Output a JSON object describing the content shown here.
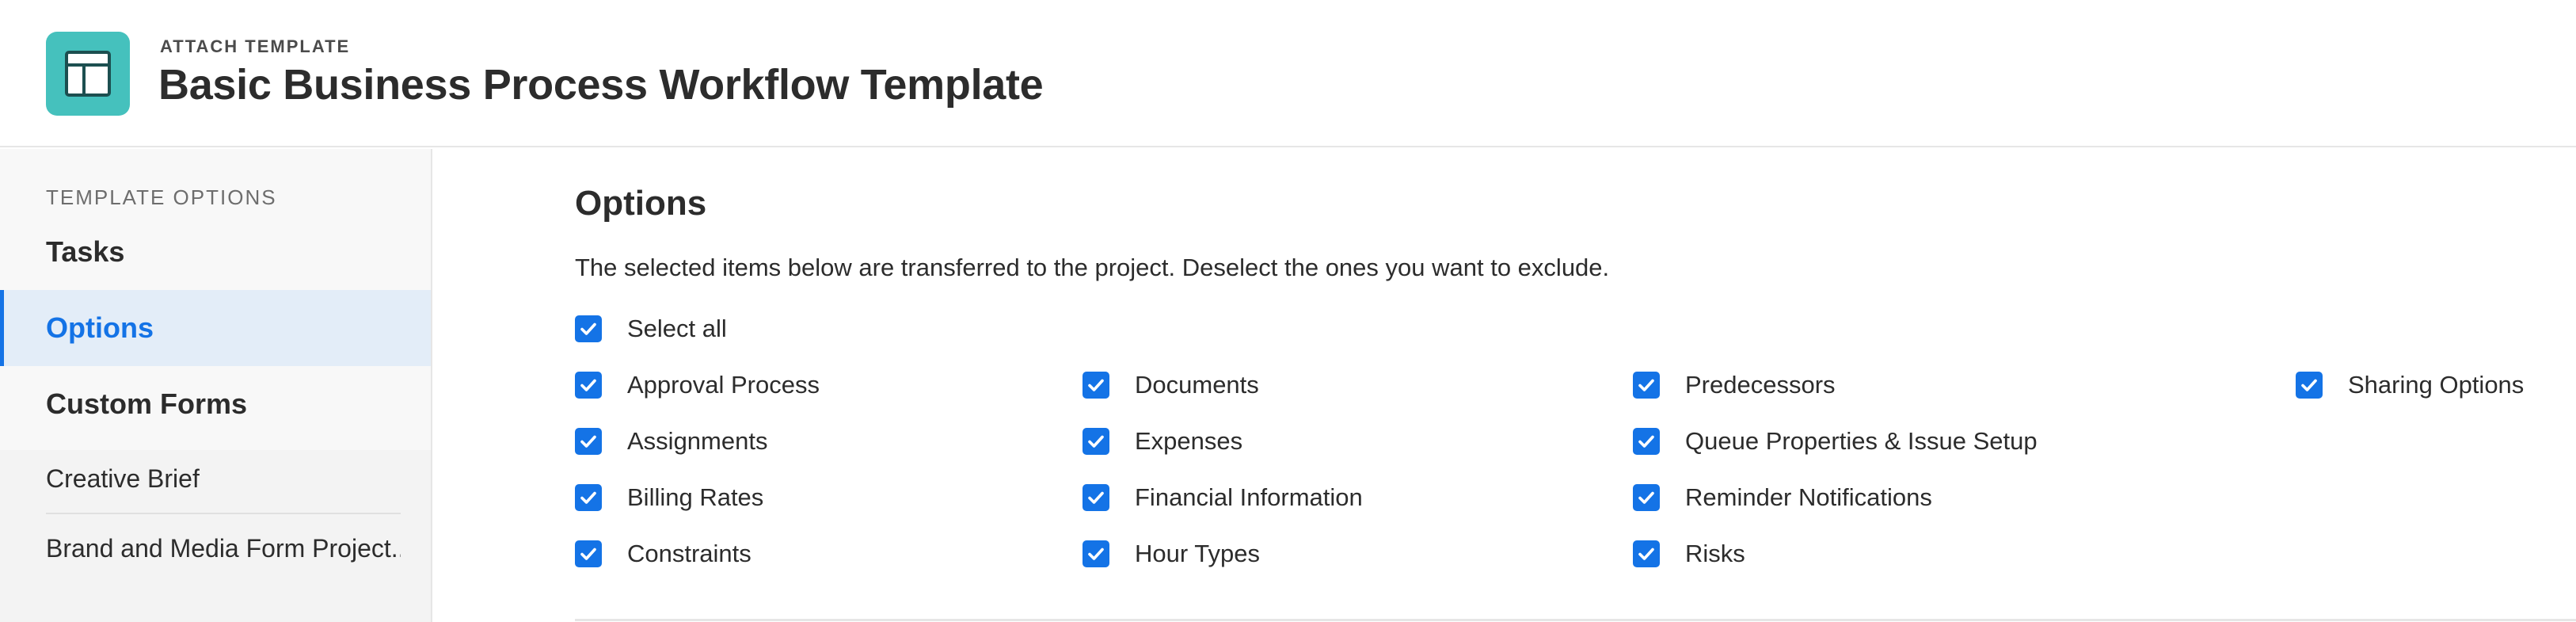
{
  "header": {
    "eyebrow": "ATTACH TEMPLATE",
    "title": "Basic Business Process Workflow Template",
    "icon": "template-layout-icon",
    "icon_color": "#45c1bd"
  },
  "sidebar": {
    "section_label": "TEMPLATE OPTIONS",
    "items": [
      {
        "label": "Tasks",
        "active": false
      },
      {
        "label": "Options",
        "active": true
      },
      {
        "label": "Custom Forms",
        "active": false
      }
    ],
    "sub_items": [
      {
        "label": "Creative Brief"
      },
      {
        "label": "Brand and Media Form Project..."
      }
    ]
  },
  "main": {
    "title": "Options",
    "description": "The selected items below are transferred to the project. Deselect the ones you want to exclude.",
    "select_all": {
      "label": "Select all",
      "checked": true
    },
    "columns": [
      [
        {
          "label": "Approval Process",
          "checked": true
        },
        {
          "label": "Assignments",
          "checked": true
        },
        {
          "label": "Billing Rates",
          "checked": true
        },
        {
          "label": "Constraints",
          "checked": true
        }
      ],
      [
        {
          "label": "Documents",
          "checked": true
        },
        {
          "label": "Expenses",
          "checked": true
        },
        {
          "label": "Financial Information",
          "checked": true
        },
        {
          "label": "Hour Types",
          "checked": true
        }
      ],
      [
        {
          "label": "Predecessors",
          "checked": true
        },
        {
          "label": "Queue Properties & Issue Setup",
          "checked": true
        },
        {
          "label": "Reminder Notifications",
          "checked": true
        },
        {
          "label": "Risks",
          "checked": true
        }
      ],
      [
        {
          "label": "Sharing Options",
          "checked": true
        }
      ]
    ]
  },
  "colors": {
    "accent": "#1473e6",
    "active_bg": "#e3edf8"
  }
}
